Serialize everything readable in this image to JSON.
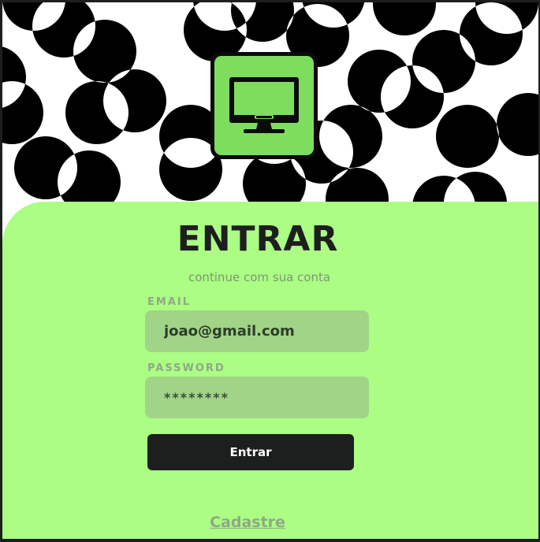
{
  "login": {
    "title": "ENTRAR",
    "subtitle": "continue com sua conta",
    "email": {
      "label": "EMAIL",
      "value": "joao@gmail.com"
    },
    "password": {
      "label": "PASSWORD",
      "value": "********"
    },
    "submit_label": "Entrar",
    "signup_link": "Cadastre"
  },
  "icons": {
    "logo": "monitor-icon",
    "background": "circle-pattern"
  },
  "colors": {
    "panel": "#abfd84",
    "logo_bg": "#7fdd5d",
    "input_bg": "#a1d487",
    "button": "#1d1f1f",
    "label": "#8fa886"
  }
}
